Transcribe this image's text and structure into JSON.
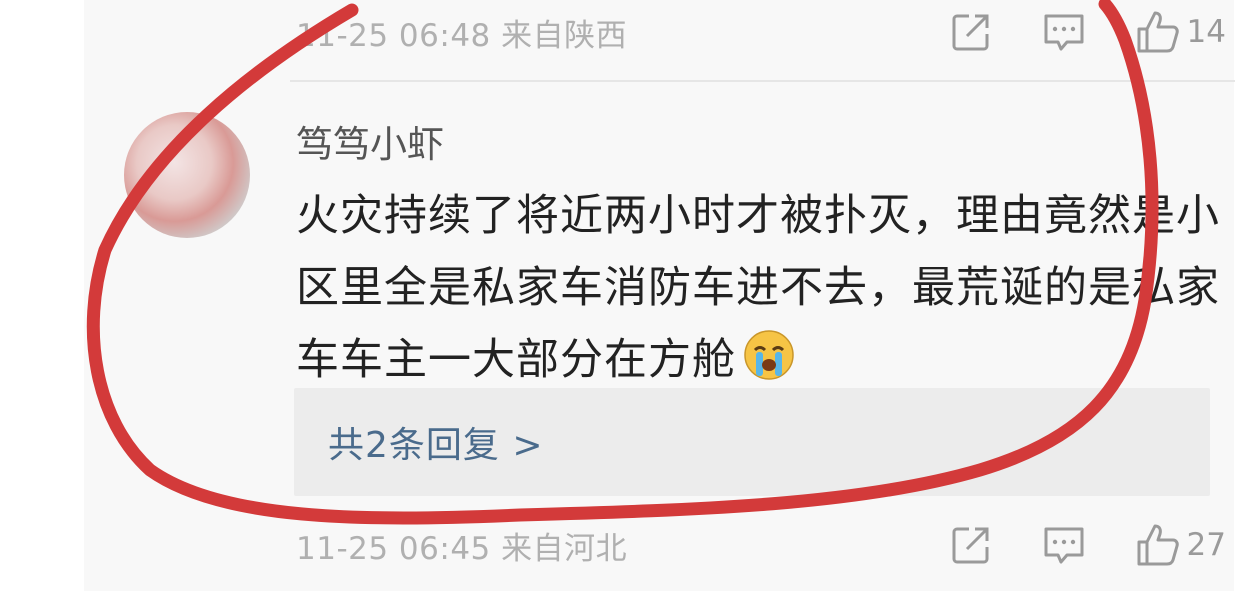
{
  "top_bar": {
    "meta": "11-25 06:48 来自陕西",
    "like_count": "14"
  },
  "comment": {
    "username": "笃笃小虾",
    "text": "火灾持续了将近两小时才被扑灭，理由竟然是小区里全是私家车消防车进不去，最荒诞的是私家车车主一大部分在方舱",
    "emoji_icon": "crying-face-icon",
    "replies_label": "共2条回复 >",
    "meta": "11-25 06:45 来自河北",
    "like_count": "27"
  },
  "annotation_color": "#d33a3a"
}
